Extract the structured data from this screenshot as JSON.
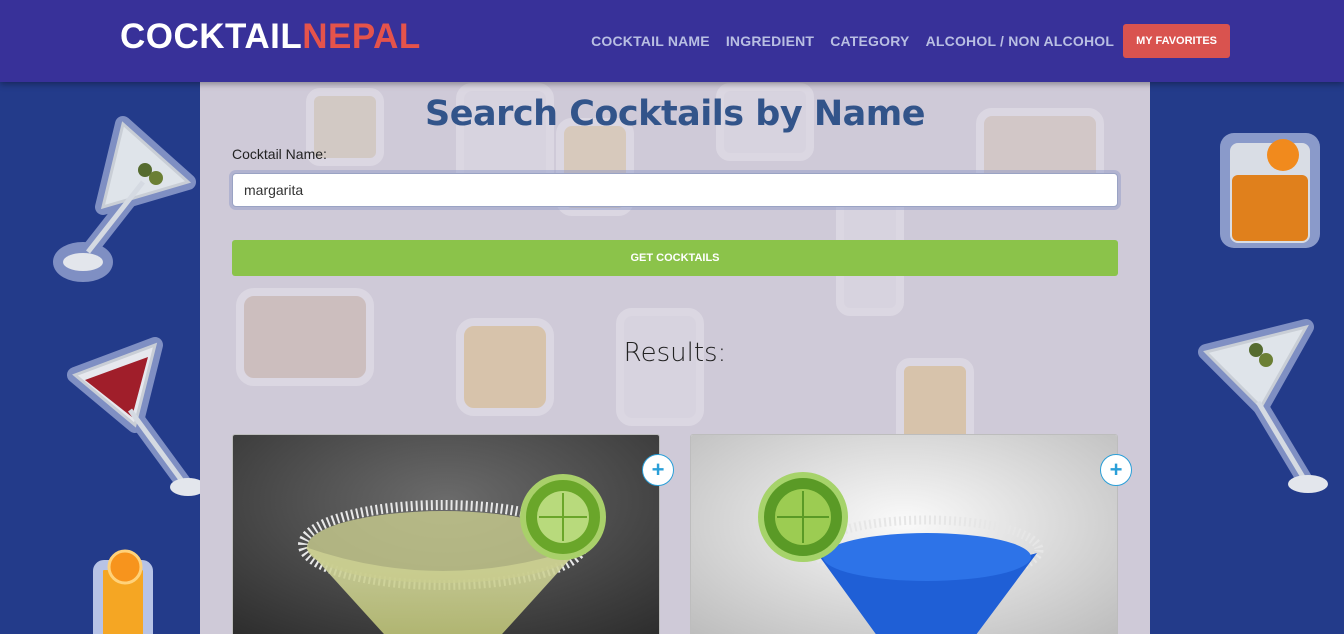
{
  "brand": {
    "part1": "COCKTAIL",
    "part2": "NEPAL"
  },
  "nav": {
    "links": [
      "COCKTAIL NAME",
      "INGREDIENT",
      "CATEGORY",
      "ALCOHOL / NON ALCOHOL"
    ],
    "favorites_label": "MY FAVORITES"
  },
  "search": {
    "title": "Search Cocktails by Name",
    "label": "Cocktail Name:",
    "value": "margarita",
    "button_label": "GET COCKTAILS"
  },
  "results": {
    "title": "Results:",
    "add_symbol": "+",
    "cards": [
      {
        "image_icon": "margarita-glass-image"
      },
      {
        "image_icon": "blue-margarita-glass-image"
      }
    ]
  },
  "colors": {
    "navbar": "#383199",
    "brand_accent": "#e5534b",
    "favorites_button": "#d9534f",
    "get_button": "#8bc34a",
    "title": "#32548a",
    "page_bg": "#233b8a"
  }
}
